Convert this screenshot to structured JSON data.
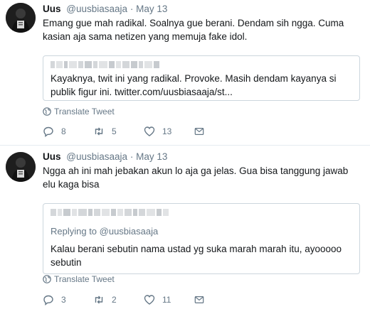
{
  "tweets": [
    {
      "name": "Uus",
      "handle": "@uusbiasaaja",
      "separator": "·",
      "date": "May 13",
      "text": "Emang gue mah radikal. Soalnya gue berani. Dendam sih ngga. Cuma kasian aja sama netizen yang memuja fake idol.",
      "quote": {
        "text": "Kayaknya, twit ini yang radikal. Provoke. Masih dendam kayanya si publik figur ini. twitter.com/uusbiasaaja/st..."
      },
      "translate_label": "Translate Tweet",
      "actions": {
        "replies": "8",
        "retweets": "5",
        "likes": "13"
      }
    },
    {
      "name": "Uus",
      "handle": "@uusbiasaaja",
      "separator": "·",
      "date": "May 13",
      "text": "Ngga ah ini mah jebakan akun lo aja ga jelas. Gua bisa tanggung jawab elu kaga bisa",
      "quote": {
        "replying": "Replying to @uusbiasaaja",
        "text": "Kalau berani sebutin nama ustad yg suka marah marah itu, ayooooo sebutin"
      },
      "translate_label": "Translate Tweet",
      "actions": {
        "replies": "3",
        "retweets": "2",
        "likes": "11"
      }
    }
  ],
  "icons": [
    "reply-icon",
    "retweet-icon",
    "like-icon",
    "direct-message-icon",
    "globe-icon"
  ],
  "colors": {
    "secondary_text": "#657786",
    "border": "#e6ecf0",
    "primary_text": "#14171a"
  }
}
